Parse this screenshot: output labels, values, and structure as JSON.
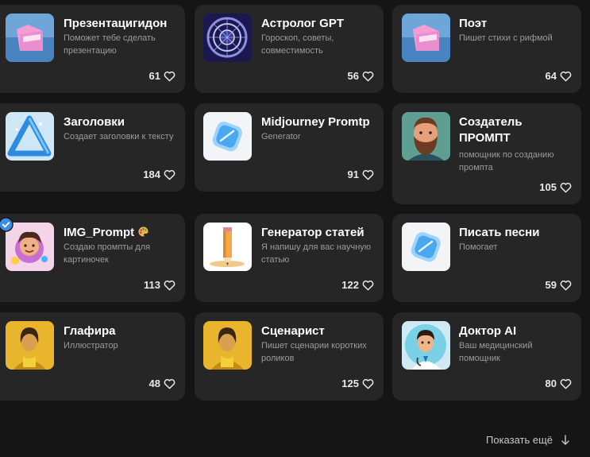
{
  "cards": [
    {
      "title": "Презентацигидон",
      "desc": "Поможет тебе сделать презентацию",
      "likes": "61"
    },
    {
      "title": "Астролог GPT",
      "desc": "Гороскоп, советы, совместимость",
      "likes": "56"
    },
    {
      "title": "Поэт",
      "desc": "Пишет стихи с рифмой",
      "likes": "64"
    },
    {
      "title": "Заголовки",
      "desc": "Создает заголовки к тексту",
      "likes": "184"
    },
    {
      "title": "Midjourney Promtp",
      "desc": "Generator",
      "likes": "91"
    },
    {
      "title": "Создатель ПРОМПТ",
      "desc": "помощник по созданию промпта",
      "likes": "105"
    },
    {
      "title": "IMG_Prompt",
      "desc": "Создаю промпты для картиночек",
      "likes": "113"
    },
    {
      "title": "Генератор статей",
      "desc": "Я напишу для вас научную статью",
      "likes": "122"
    },
    {
      "title": "Писать песни",
      "desc": "Помогает",
      "likes": "59"
    },
    {
      "title": "Глафира",
      "desc": "Иллюстратор",
      "likes": "48"
    },
    {
      "title": "Сценарист",
      "desc": "Пишет сценарии коротких роликов",
      "likes": "125"
    },
    {
      "title": "Доктор AI",
      "desc": "Ваш медицинский помощник",
      "likes": "80"
    }
  ],
  "show_more_label": "Показать ещё",
  "colors": {
    "background": "#151515",
    "card": "#262626",
    "text": "#ffffff",
    "muted": "#9b9b9b",
    "verified": "#3b8ee8"
  }
}
